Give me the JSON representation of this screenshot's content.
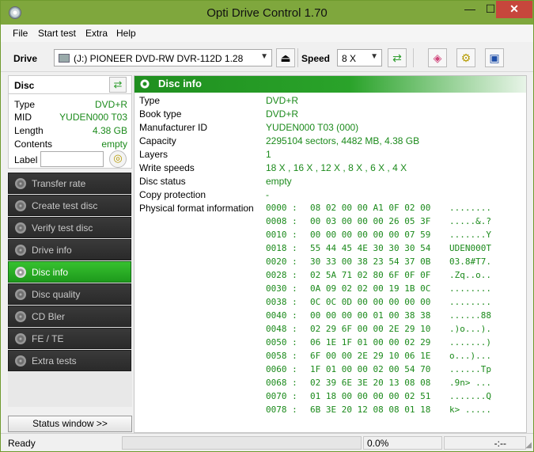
{
  "window": {
    "title": "Opti Drive Control 1.70",
    "minimize": "—",
    "maximize": "☐",
    "close": "✕"
  },
  "menu": [
    "File",
    "Start test",
    "Extra",
    "Help"
  ],
  "toolbar": {
    "drive_label": "Drive",
    "drive_value": "(J:)  PIONEER DVD-RW  DVR-112D 1.28",
    "speed_label": "Speed",
    "speed_value": "8 X",
    "icons": [
      "eject-icon",
      "refresh-icon",
      "eraser-icon",
      "settings-icon",
      "save-icon"
    ]
  },
  "disc": {
    "title": "Disc",
    "props": [
      {
        "key": "Type",
        "value": "DVD+R"
      },
      {
        "key": "MID",
        "value": "YUDEN000 T03"
      },
      {
        "key": "Length",
        "value": "4.38 GB"
      },
      {
        "key": "Contents",
        "value": "empty"
      }
    ],
    "label_key": "Label",
    "label_value": ""
  },
  "nav": [
    {
      "label": "Transfer rate",
      "active": false
    },
    {
      "label": "Create test disc",
      "active": false
    },
    {
      "label": "Verify test disc",
      "active": false
    },
    {
      "label": "Drive info",
      "active": false
    },
    {
      "label": "Disc info",
      "active": true
    },
    {
      "label": "Disc quality",
      "active": false
    },
    {
      "label": "CD Bler",
      "active": false
    },
    {
      "label": "FE / TE",
      "active": false
    },
    {
      "label": "Extra tests",
      "active": false
    }
  ],
  "status_button": "Status window >>",
  "panel": {
    "title": "Disc info",
    "info": [
      {
        "key": "Type",
        "value": "DVD+R"
      },
      {
        "key": "Book type",
        "value": "DVD+R"
      },
      {
        "key": "Manufacturer ID",
        "value": "YUDEN000 T03 (000)"
      },
      {
        "key": "Capacity",
        "value": "2295104 sectors, 4482 MB, 4.38 GB"
      },
      {
        "key": "Layers",
        "value": "1"
      },
      {
        "key": "Write speeds",
        "value": "18 X , 16 X , 12 X , 8 X , 6 X , 4 X"
      },
      {
        "key": "Disc status",
        "value": "empty"
      },
      {
        "key": "Copy protection",
        "value": "-"
      },
      {
        "key": "Physical format information",
        "value": ""
      }
    ],
    "hex": [
      {
        "off": "0000 :",
        "bytes": "08 02 00 00 A1 0F 02 00",
        "ascii": "........"
      },
      {
        "off": "0008 :",
        "bytes": "00 03 00 00 00 26 05 3F",
        "ascii": ".....&.?"
      },
      {
        "off": "0010 :",
        "bytes": "00 00 00 00 00 00 07 59",
        "ascii": ".......Y"
      },
      {
        "off": "0018 :",
        "bytes": "55 44 45 4E 30 30 30 54",
        "ascii": "UDEN000T"
      },
      {
        "off": "0020 :",
        "bytes": "30 33 00 38 23 54 37 0B",
        "ascii": "03.8#T7."
      },
      {
        "off": "0028 :",
        "bytes": "02 5A 71 02 80 6F 0F 0F",
        "ascii": ".Zq..o.."
      },
      {
        "off": "0030 :",
        "bytes": "0A 09 02 02 00 19 1B 0C",
        "ascii": "........"
      },
      {
        "off": "0038 :",
        "bytes": "0C 0C 0D 00 00 00 00 00",
        "ascii": "........"
      },
      {
        "off": "0040 :",
        "bytes": "00 00 00 00 01 00 38 38",
        "ascii": "......88"
      },
      {
        "off": "0048 :",
        "bytes": "02 29 6F 00 00 2E 29 10",
        "ascii": ".)o...)."
      },
      {
        "off": "0050 :",
        "bytes": "06 1E 1F 01 00 00 02 29",
        "ascii": ".......)"
      },
      {
        "off": "0058 :",
        "bytes": "6F 00 00 2E 29 10 06 1E",
        "ascii": "o...)..."
      },
      {
        "off": "0060 :",
        "bytes": "1F 01 00 00 02 00 54 70",
        "ascii": "......Tp"
      },
      {
        "off": "0068 :",
        "bytes": "02 39 6E 3E 20 13 08 08",
        "ascii": ".9n> ..."
      },
      {
        "off": "0070 :",
        "bytes": "01 18 00 00 00 00 02 51",
        "ascii": ".......Q"
      },
      {
        "off": "0078 :",
        "bytes": "6B 3E 20 12 08 08 01 18",
        "ascii": "k> ....."
      }
    ]
  },
  "statusbar": {
    "status": "Ready",
    "progress": "0.0%",
    "time": "-:--"
  }
}
